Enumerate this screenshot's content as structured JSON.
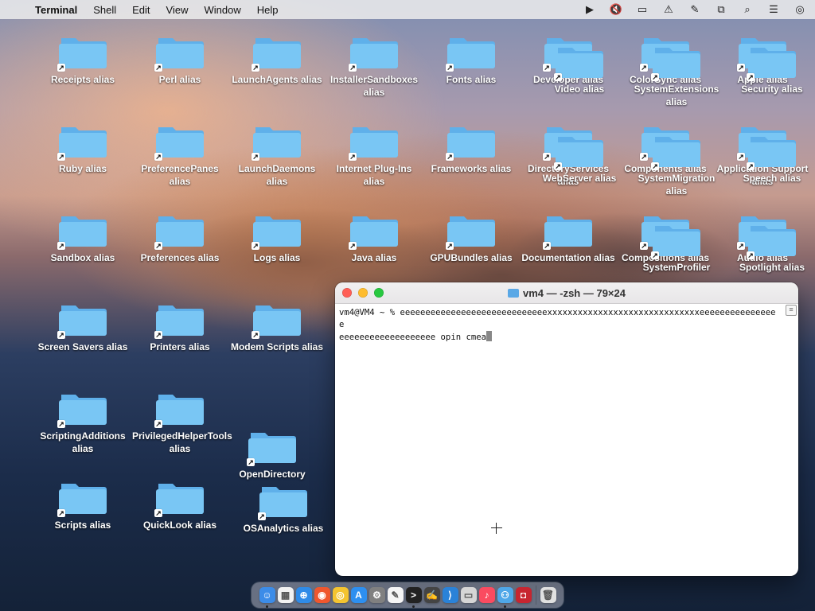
{
  "menubar": {
    "app_name": "Terminal",
    "items": [
      "Shell",
      "Edit",
      "View",
      "Window",
      "Help"
    ],
    "status_icons": [
      "play-icon",
      "muted-speaker-icon",
      "display-icon",
      "wifi-off-icon",
      "no-pen-icon",
      "screen-mirroring-icon",
      "search-icon",
      "control-center-icon",
      "siri-icon"
    ]
  },
  "desktop": {
    "items": [
      {
        "label": "Receipts alias"
      },
      {
        "label": "Perl alias"
      },
      {
        "label": "LaunchAgents alias"
      },
      {
        "label": "InstallerSandboxes alias"
      },
      {
        "label": "Fonts alias"
      },
      {
        "label": "Developer alias"
      },
      {
        "label": "ColorSync alias"
      },
      {
        "label": "Apple alias"
      },
      {
        "label": "Video alias"
      },
      {
        "label": "SystemExtensions alias"
      },
      {
        "label": "Security alias"
      },
      {
        "label": "Ruby alias"
      },
      {
        "label": "PreferencePanes alias"
      },
      {
        "label": "LaunchDaemons alias"
      },
      {
        "label": "Internet Plug-Ins alias"
      },
      {
        "label": "Frameworks alias"
      },
      {
        "label": "DirectoryServices alias"
      },
      {
        "label": "Components alias"
      },
      {
        "label": "Application Support alias"
      },
      {
        "label": "WebServer alias"
      },
      {
        "label": "SystemMigration alias"
      },
      {
        "label": "Speech alias"
      },
      {
        "label": "Sandbox alias"
      },
      {
        "label": "Preferences alias"
      },
      {
        "label": "Logs alias"
      },
      {
        "label": "Java alias"
      },
      {
        "label": "GPUBundles alias"
      },
      {
        "label": "Documentation alias"
      },
      {
        "label": "Compositions alias"
      },
      {
        "label": "Audio alias"
      },
      {
        "label": "SystemProfiler"
      },
      {
        "label": "Spotlight alias"
      },
      {
        "label": "Screen Savers alias"
      },
      {
        "label": "Printers alias"
      },
      {
        "label": "Modem Scripts alias"
      },
      {
        "label": "ScriptingAdditions alias"
      },
      {
        "label": "PrivilegedHelperTools alias"
      },
      {
        "label": "OpenDirectory"
      },
      {
        "label": "Scripts alias"
      },
      {
        "label": "QuickLook alias"
      },
      {
        "label": "OSAnalytics alias"
      }
    ]
  },
  "terminal": {
    "title": "vm4 — -zsh — 79×24",
    "content": "vm4@VM4 ~ % eeeeeeeeeeeeeeeeeeeeeeeeeeeeexxxxxxxxxxxxxxxxxxxxxxxxxxxxxxeeeeeeeeeeeeeeee\neeeeeeeeeeeeeeeeeee opin cmea"
  },
  "dock": {
    "apps": [
      {
        "name": "finder-icon",
        "color": "#3c8ce8",
        "glyph": "☺",
        "running": true
      },
      {
        "name": "launchpad-icon",
        "color": "#f2f2f2",
        "glyph": "▦",
        "running": false
      },
      {
        "name": "safari-icon",
        "color": "#2f8be8",
        "glyph": "⊕",
        "running": false
      },
      {
        "name": "firefox-icon",
        "color": "#f0572e",
        "glyph": "◉",
        "running": false
      },
      {
        "name": "chrome-icon",
        "color": "#f4c430",
        "glyph": "◎",
        "running": false
      },
      {
        "name": "app-store-icon",
        "color": "#2d8ff0",
        "glyph": "A",
        "running": false
      },
      {
        "name": "system-preferences-icon",
        "color": "#808080",
        "glyph": "⚙",
        "running": false
      },
      {
        "name": "textedit-icon",
        "color": "#f5f5f5",
        "glyph": "✎",
        "running": false
      },
      {
        "name": "terminal-icon",
        "color": "#222222",
        "glyph": ">",
        "running": true
      },
      {
        "name": "script-editor-icon",
        "color": "#444444",
        "glyph": "✍",
        "running": false
      },
      {
        "name": "vscode-icon",
        "color": "#2a82d8",
        "glyph": "⟩",
        "running": false
      },
      {
        "name": "preview-icon",
        "color": "#d6d6d6",
        "glyph": "▭",
        "running": false
      },
      {
        "name": "music-icon",
        "color": "#fa4b60",
        "glyph": "♪",
        "running": false
      },
      {
        "name": "network-icon",
        "color": "#4fa7e8",
        "glyph": "⚇",
        "running": true
      },
      {
        "name": "photo-booth-icon",
        "color": "#c72530",
        "glyph": "◘",
        "running": false
      },
      {
        "name": "trash-icon",
        "color": "#e0e0e0",
        "glyph": "🗑",
        "running": false
      }
    ]
  }
}
